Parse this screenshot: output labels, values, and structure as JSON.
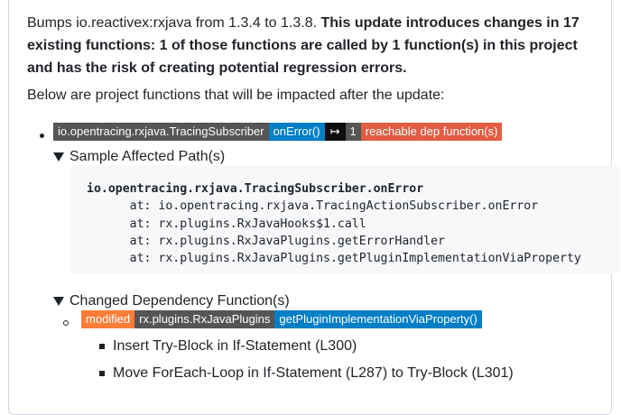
{
  "intro": {
    "plain": "Bumps io.reactivex:rxjava from 1.3.4 to 1.3.8. ",
    "bold": "This update introduces changes in 17 existing functions: 1 of those functions are called by 1 function(s) in this project and has the risk of creating potential regression errors."
  },
  "below_text": "Below are project functions that will be impacted after the update:",
  "impact": {
    "class_badge": "io.opentracing.rxjava.TracingSubscriber",
    "method_badge": "onError()",
    "arrow_glyph": "↦",
    "count_badge": "1",
    "reach_badge": "reachable dep function(s)"
  },
  "sample_summary": "Sample Affected Path(s)",
  "code": {
    "head": "io.opentracing.rxjava.TracingSubscriber.onError",
    "lines": [
      "      at: io.opentracing.rxjava.TracingActionSubscriber.onError",
      "      at: rx.plugins.RxJavaHooks$1.call",
      "      at: rx.plugins.RxJavaPlugins.getErrorHandler",
      "      at: rx.plugins.RxJavaPlugins.getPluginImplementationViaProperty"
    ]
  },
  "changed_summary": "Changed Dependency Function(s)",
  "change": {
    "status_badge": "modified",
    "class_badge": "rx.plugins.RxJavaPlugins",
    "method_badge": "getPluginImplementationViaProperty()"
  },
  "changes": [
    "Insert Try-Block in If-Statement (L300)",
    "Move ForEach-Loop in If-Statement (L287) to Try-Block (L301)"
  ],
  "colors": {
    "badge_dark": "#555555",
    "badge_blue": "#007ec6",
    "badge_red": "#e05d44",
    "badge_orange": "#fe7d37",
    "code_bg": "#f6f8fa"
  }
}
